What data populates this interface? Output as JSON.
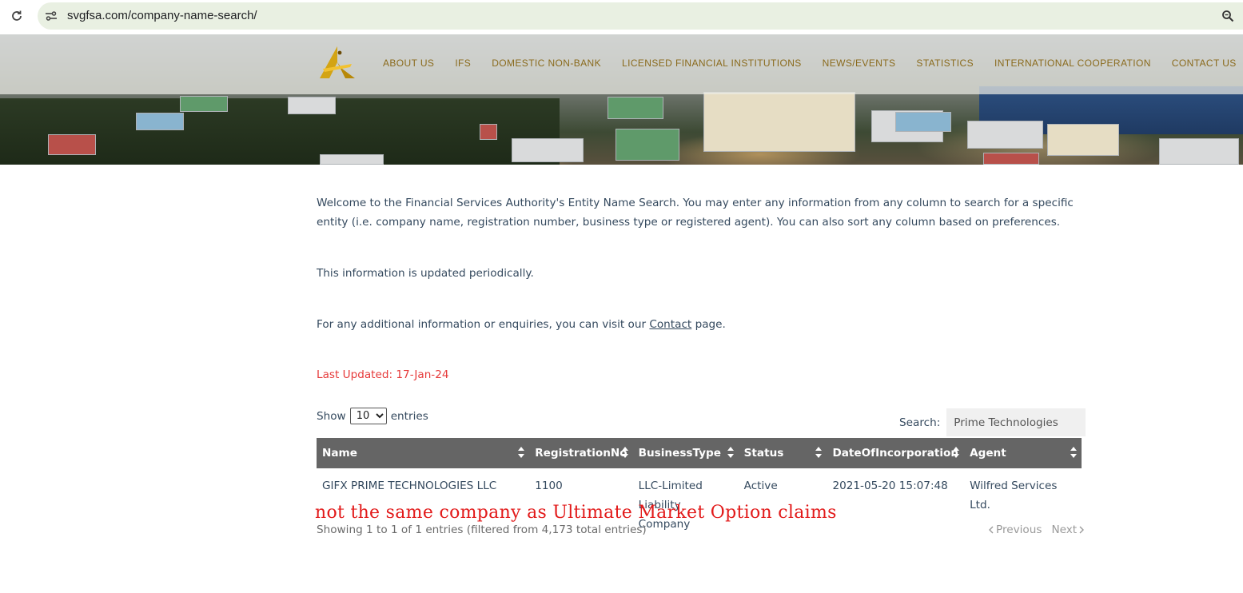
{
  "browser": {
    "url": "svgfsa.com/company-name-search/"
  },
  "nav": {
    "items": [
      "ABOUT US",
      "IFS",
      "DOMESTIC NON-BANK",
      "LICENSED FINANCIAL INSTITUTIONS",
      "NEWS/EVENTS",
      "STATISTICS",
      "INTERNATIONAL COOPERATION",
      "CONTACT US"
    ],
    "accent_color": "#8a6a1c"
  },
  "intro": {
    "welcome": "Welcome to the Financial Services Authority's Entity Name Search. You may enter any information from any column to search for a specific entity (i.e. company name, registration number, business type or registered agent). You can also sort any column based on preferences.",
    "updated_note": "This information is updated periodically.",
    "enquiry_prefix": "For any additional information or enquiries, you can visit our ",
    "enquiry_link": "Contact",
    "enquiry_suffix": " page.",
    "last_updated": "Last Updated:  17-Jan-24"
  },
  "table_controls": {
    "show_label": "Show",
    "page_size": "10",
    "entries_label": "entries",
    "search_label": "Search:",
    "search_value": "Prime Technologies"
  },
  "table": {
    "columns": [
      "Name",
      "RegistrationNo",
      "BusinessType",
      "Status",
      "DateOfIncorporation",
      "Agent"
    ],
    "rows": [
      {
        "name": "GIFX PRIME TECHNOLOGIES LLC",
        "registration_no": "1100",
        "business_type": "LLC-Limited Liability Company",
        "status": "Active",
        "date_of_incorporation": "2021-05-20 15:07:48",
        "agent": "Wilfred Services Ltd."
      }
    ]
  },
  "footer": {
    "info": "Showing 1 to 1 of 1 entries (filtered from 4,173 total entries)",
    "previous": "Previous",
    "next": "Next"
  },
  "annotation": {
    "text": "not the same company as Ultimate Market Option claims",
    "color": "#e21a1a"
  }
}
